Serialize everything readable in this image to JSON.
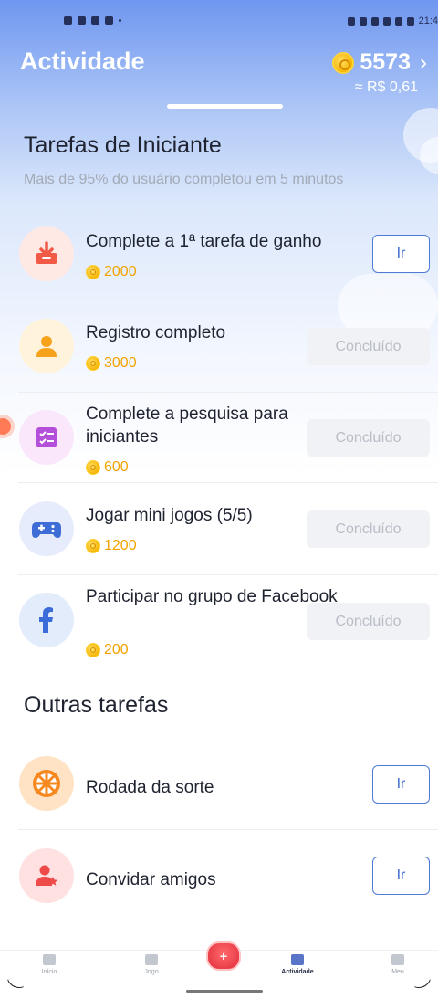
{
  "status_bar": {
    "time": "21:4"
  },
  "header": {
    "title": "Actividade",
    "coin_balance": "5573",
    "balance_money": "≈ R$ 0,61",
    "chevron": "›"
  },
  "beginner": {
    "title": "Tarefas de Iniciante",
    "subtitle": "Mais de 95% do usuário completou em 5 minutos",
    "tasks": [
      {
        "name": "Complete a 1ª tarefa de ganho",
        "reward": "2000",
        "button": "Ir",
        "icon": "download-tray-icon"
      },
      {
        "name": "Registro completo",
        "reward": "3000",
        "button": "Concluído",
        "icon": "user-icon"
      },
      {
        "name": "Complete a pesquisa para iniciantes",
        "reward": "600",
        "button": "Concluído",
        "icon": "checklist-icon"
      },
      {
        "name": "Jogar mini jogos (5/5)",
        "reward": "1200",
        "button": "Concluído",
        "icon": "gamepad-icon"
      },
      {
        "name": "Participar no grupo de Facebook",
        "reward": "200",
        "button": "Concluído",
        "icon": "facebook-icon"
      }
    ]
  },
  "other": {
    "title": "Outras tarefas",
    "tasks": [
      {
        "name": "Rodada da sorte",
        "button": "Ir",
        "icon": "wheel-icon"
      },
      {
        "name": "Convidar amigos",
        "button": "Ir",
        "icon": "invite-user-icon"
      }
    ]
  },
  "nav": {
    "items": [
      {
        "label": "Início"
      },
      {
        "label": "Jogo"
      },
      {
        "label": "Actividade"
      },
      {
        "label": "Meu"
      }
    ],
    "center_label": "+"
  },
  "colors": {
    "accent": "#4f7bd6",
    "coin": "#f5b400",
    "done_bg": "#f1f2f5"
  }
}
